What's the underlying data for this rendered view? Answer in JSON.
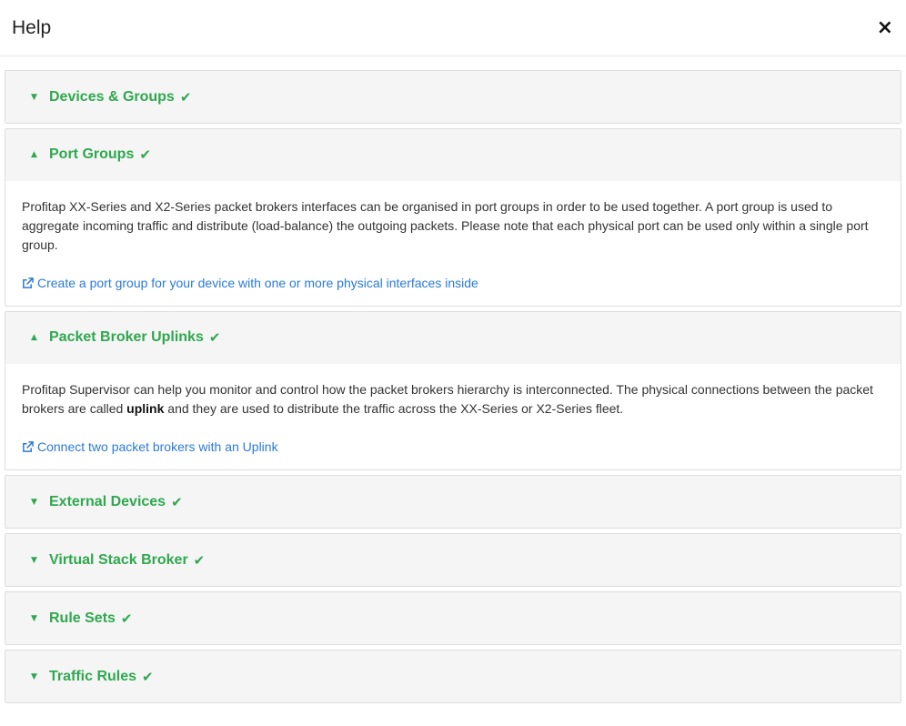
{
  "header": {
    "title": "Help",
    "close_symbol": "×"
  },
  "colors": {
    "accent_green": "#2fa84f",
    "link_blue": "#2a7ad6"
  },
  "icons": {
    "check": "check-icon",
    "caret_down": "caret-down-icon",
    "caret_up": "caret-up-icon",
    "external": "external-link-icon"
  },
  "panels": [
    {
      "title": "Devices & Groups"
    },
    {
      "title": "Port Groups",
      "body": "Profitap XX-Series and X2-Series packet brokers interfaces can be organised in port groups in order to be used together. A port group is used to aggregate incoming traffic and distribute (load-balance) the outgoing packets. Please note that each physical port can be used only within a single port group.",
      "link": "Create a port group for your device with one or more physical interfaces inside"
    },
    {
      "title": "Packet Broker Uplinks",
      "body_before": "Profitap Supervisor can help you monitor and control how the packet brokers hierarchy is interconnected. The physical connections between the packet brokers are called ",
      "body_bold": "uplink",
      "body_after": " and they are used to distribute the traffic across the XX-Series or X2-Series fleet.",
      "link": "Connect two packet brokers with an Uplink"
    },
    {
      "title": "External Devices"
    },
    {
      "title": "Virtual Stack Broker"
    },
    {
      "title": "Rule Sets"
    },
    {
      "title": "Traffic Rules"
    }
  ]
}
